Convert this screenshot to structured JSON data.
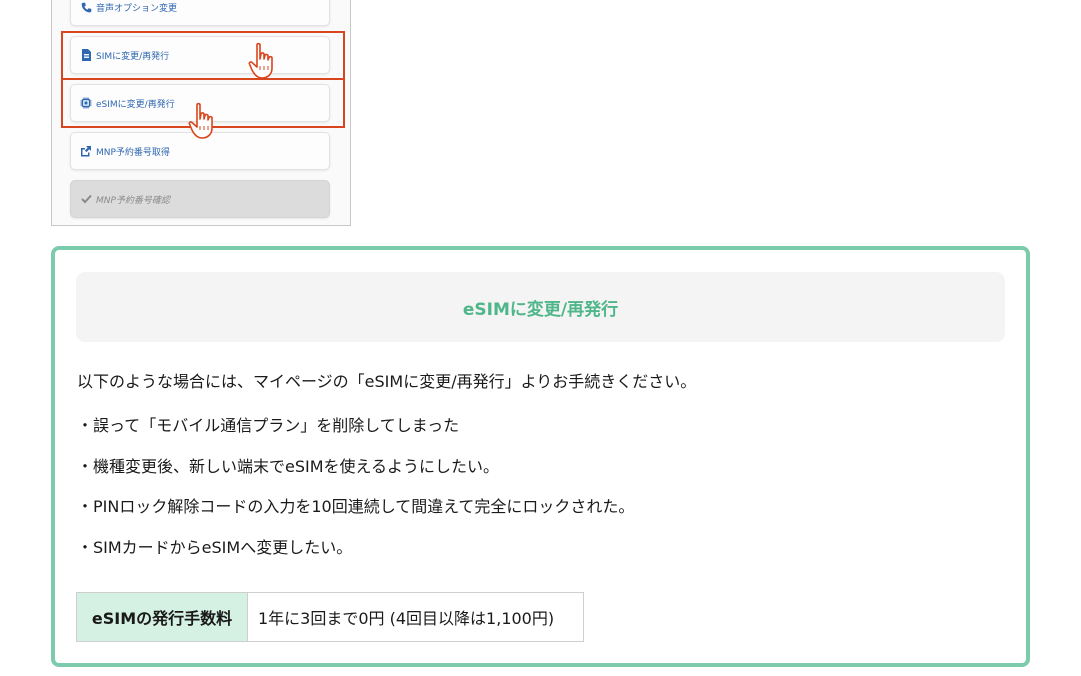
{
  "menu": {
    "items": [
      {
        "label": "音声オプション変更",
        "icon": "phone-icon",
        "disabled": false
      },
      {
        "label": "SIMに変更/再発行",
        "icon": "sim-card-icon",
        "disabled": false
      },
      {
        "label": "eSIMに変更/再発行",
        "icon": "chip-icon",
        "disabled": false
      },
      {
        "label": "MNP予約番号取得",
        "icon": "share-icon",
        "disabled": false
      },
      {
        "label": "MNP予約番号確認",
        "icon": "check-icon",
        "disabled": true
      }
    ],
    "highlight_color": "#d9451c",
    "link_color": "#2f67b0"
  },
  "panel": {
    "title": "eSIMに変更/再発行",
    "intro": "以下のような場合には、マイページの「eSIMに変更/再発行」よりお手続きください。",
    "bullet": "・",
    "cases": [
      "誤って「モバイル通信プラン」を削除してしまった",
      "機種変更後、新しい端末でeSIMを使えるようにしたい。",
      "PINロック解除コードの入力を10回連続して間違えて完全にロックされた。",
      "SIMカードからeSIMへ変更したい。"
    ],
    "fee": {
      "label": "eSIMの発行手数料",
      "value": "1年に3回まで0円 (4回目以降は1,100円)"
    },
    "accent_color": "#4fb68a",
    "border_color": "#7ccbad"
  }
}
